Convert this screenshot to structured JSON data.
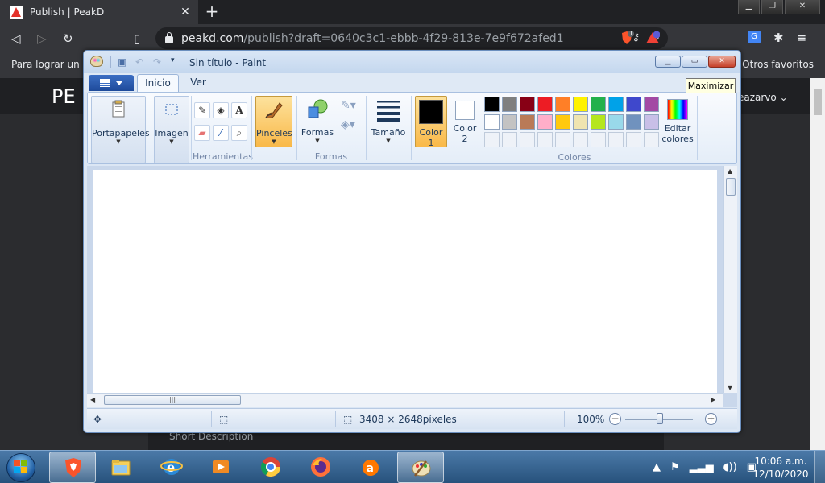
{
  "browser": {
    "tab_title": "Publish | PeakD",
    "tab_close": "✕",
    "new_tab": "+",
    "url_domain": "peakd.com",
    "url_path": "/publish?draft=0640c3c1-ebbb-4f29-813e-7e9f672afed1",
    "brave_badge_count": "1",
    "bookmark_left": "Para lograr un ac",
    "bookmark_right": "Otros favoritos"
  },
  "page": {
    "logo": "PE",
    "user": "eazarvo ⌄",
    "short_description": "Short Description"
  },
  "paint": {
    "caption": "Sin título - Paint",
    "tabs": [
      "Inicio",
      "Ver"
    ],
    "groups": {
      "portapapeles": "Portapapeles",
      "imagen": "Imagen",
      "herramientas": "Herramientas",
      "pinceles": "Pinceles",
      "formas": "Formas",
      "tamano": "Tamaño",
      "color1": "Color 1",
      "color2": "Color 2",
      "colores": "Colores",
      "editar_colores": "Editar colores"
    },
    "palette_row1": [
      "#000000",
      "#7f7f7f",
      "#880015",
      "#ed1c24",
      "#ff7f27",
      "#fff200",
      "#22b14c",
      "#00a2e8",
      "#3f48cc",
      "#a349a4"
    ],
    "palette_row2": [
      "#ffffff",
      "#c3c3c3",
      "#b97a57",
      "#ffaec9",
      "#ffc90e",
      "#efe4b0",
      "#b5e61d",
      "#99d9ea",
      "#7092be",
      "#c8bfe7"
    ],
    "color1": "#000000",
    "color2": "#ffffff",
    "status": {
      "dimensions": "3408 × 2648píxeles",
      "zoom": "100%"
    },
    "tooltip": "Maximizar"
  },
  "taskbar": {
    "time": "10:06 a.m.",
    "date": "12/10/2020"
  }
}
